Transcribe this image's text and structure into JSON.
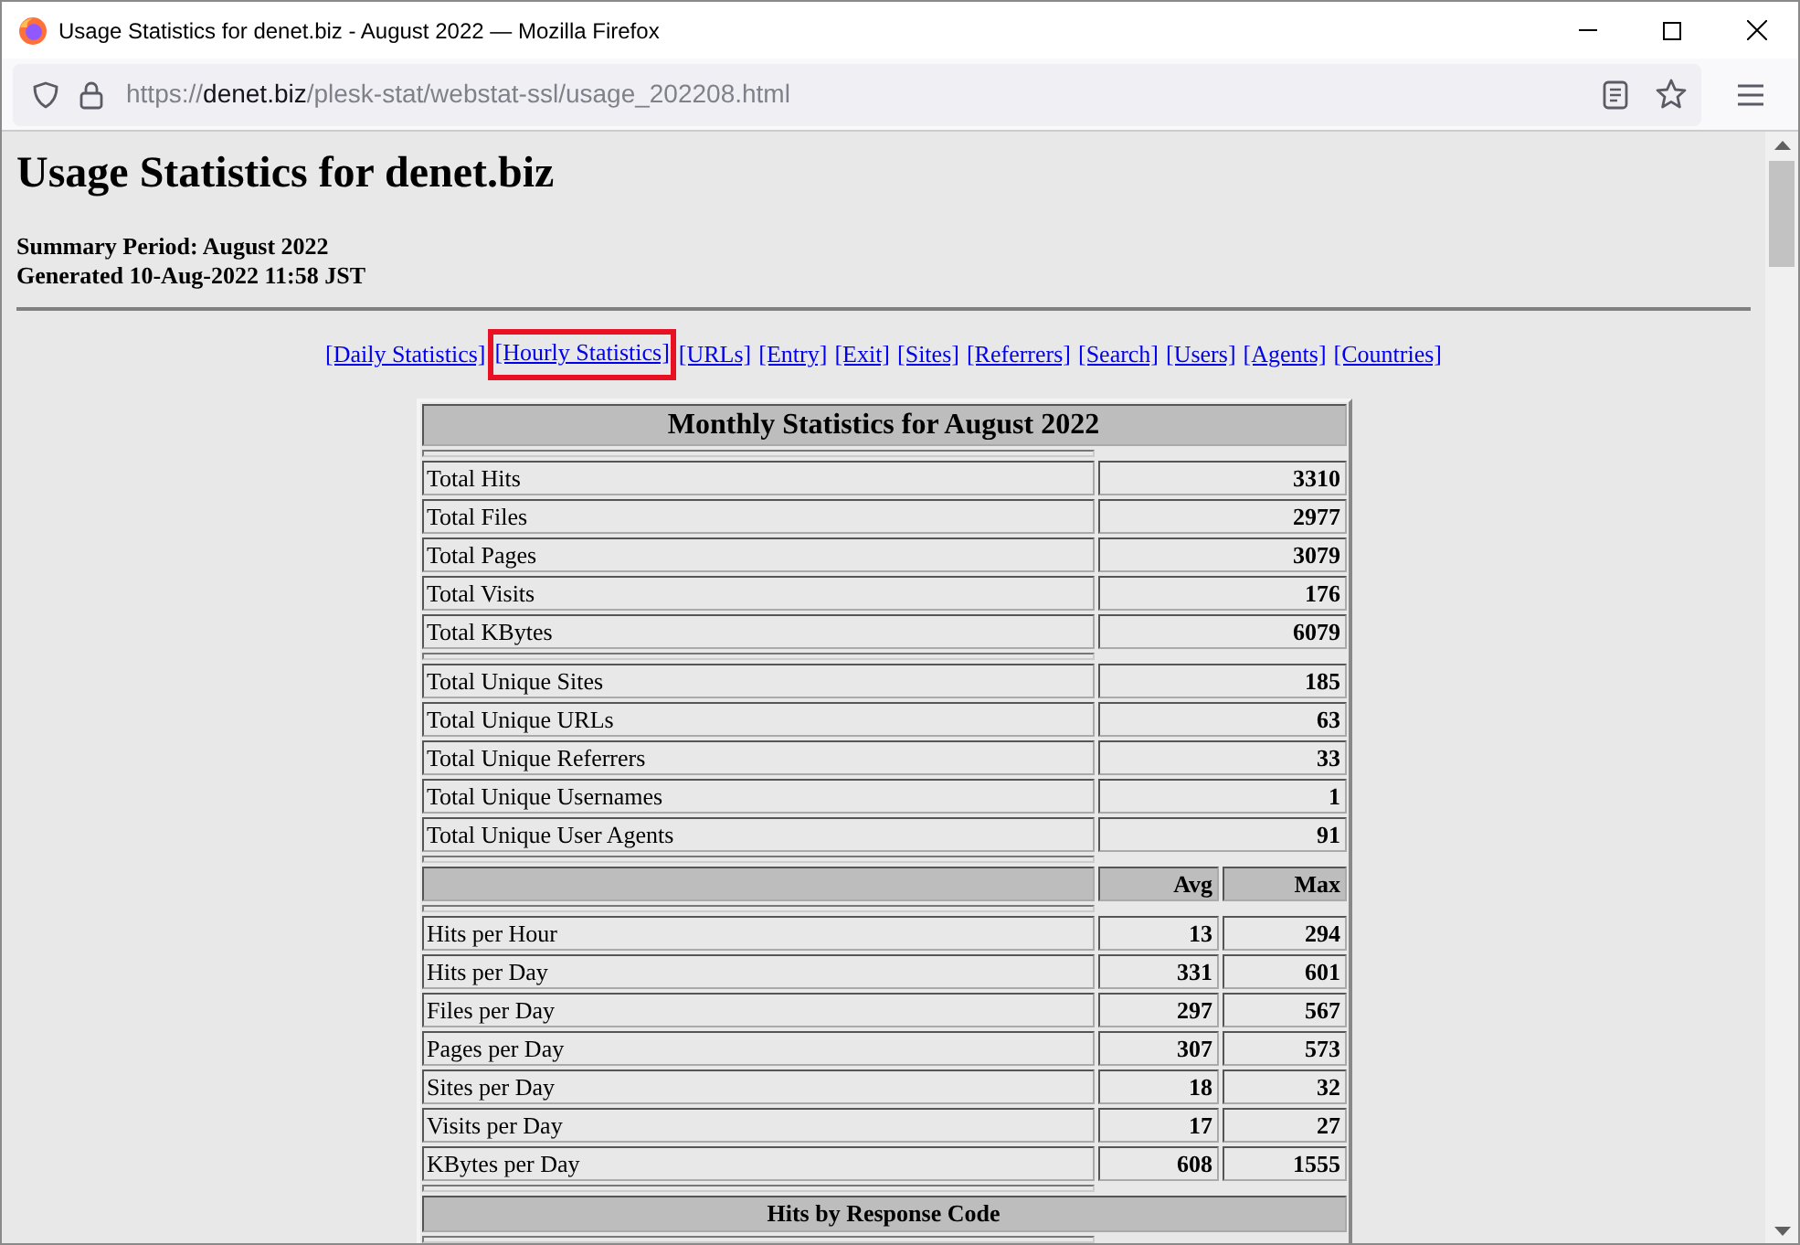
{
  "window": {
    "title": "Usage Statistics for denet.biz - August 2022 — Mozilla Firefox"
  },
  "address_bar": {
    "scheme": "https://",
    "host": "denet.biz",
    "path": "/plesk-stat/webstat-ssl/usage_202208.html"
  },
  "page": {
    "heading": "Usage Statistics for denet.biz",
    "summary_period": "Summary Period: August 2022",
    "generated": "Generated 10-Aug-2022 11:58 JST",
    "nav_links": [
      {
        "label": "[Daily Statistics]",
        "highlighted": false
      },
      {
        "label": "[Hourly Statistics]",
        "highlighted": true
      },
      {
        "label": "[URLs]",
        "highlighted": false
      },
      {
        "label": "[Entry]",
        "highlighted": false
      },
      {
        "label": "[Exit]",
        "highlighted": false
      },
      {
        "label": "[Sites]",
        "highlighted": false
      },
      {
        "label": "[Referrers]",
        "highlighted": false
      },
      {
        "label": "[Search]",
        "highlighted": false
      },
      {
        "label": "[Users]",
        "highlighted": false
      },
      {
        "label": "[Agents]",
        "highlighted": false
      },
      {
        "label": "[Countries]",
        "highlighted": false
      }
    ],
    "table": {
      "sections": [
        {
          "kind": "title",
          "text": "Monthly Statistics for August 2022"
        },
        {
          "kind": "rows",
          "rows": [
            {
              "label": "Total Hits",
              "value": "3310"
            },
            {
              "label": "Total Files",
              "value": "2977"
            },
            {
              "label": "Total Pages",
              "value": "3079"
            },
            {
              "label": "Total Visits",
              "value": "176"
            },
            {
              "label": "Total KBytes",
              "value": "6079"
            }
          ]
        },
        {
          "kind": "rows",
          "rows": [
            {
              "label": "Total Unique Sites",
              "value": "185"
            },
            {
              "label": "Total Unique URLs",
              "value": "63"
            },
            {
              "label": "Total Unique Referrers",
              "value": "33"
            },
            {
              "label": "Total Unique Usernames",
              "value": "1"
            },
            {
              "label": "Total Unique User Agents",
              "value": "91"
            }
          ]
        },
        {
          "kind": "header",
          "columns": [
            "Avg",
            "Max"
          ]
        },
        {
          "kind": "pairs",
          "rows": [
            {
              "label": "Hits per Hour",
              "avg": "13",
              "max": "294"
            },
            {
              "label": "Hits per Day",
              "avg": "331",
              "max": "601"
            },
            {
              "label": "Files per Day",
              "avg": "297",
              "max": "567"
            },
            {
              "label": "Pages per Day",
              "avg": "307",
              "max": "573"
            },
            {
              "label": "Sites per Day",
              "avg": "18",
              "max": "32"
            },
            {
              "label": "Visits per Day",
              "avg": "17",
              "max": "27"
            },
            {
              "label": "KBytes per Day",
              "avg": "608",
              "max": "1555"
            }
          ]
        },
        {
          "kind": "subtitle",
          "text": "Hits by Response Code"
        }
      ]
    }
  }
}
